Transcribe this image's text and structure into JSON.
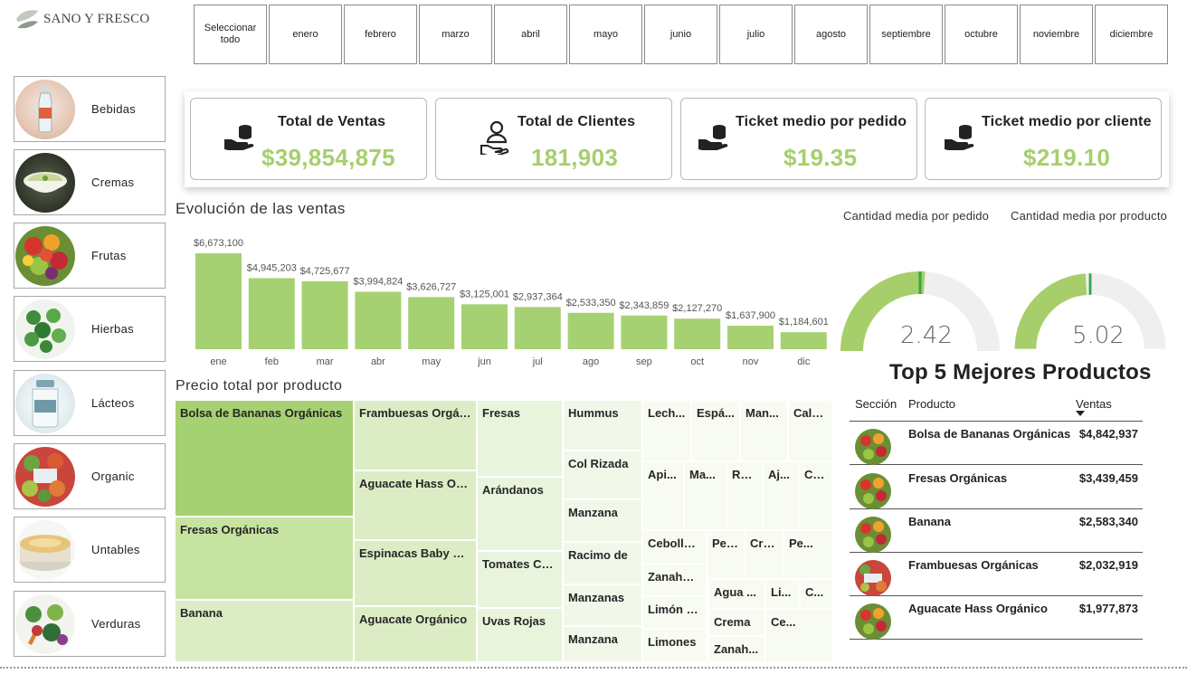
{
  "brand": {
    "name": "SANO Y FRESCO"
  },
  "months": [
    "Seleccionar todo",
    "enero",
    "febrero",
    "marzo",
    "abril",
    "mayo",
    "junio",
    "julio",
    "agosto",
    "septiembre",
    "octubre",
    "noviembre",
    "diciembre"
  ],
  "categories": [
    "Bebidas",
    "Cremas",
    "Frutas",
    "Hierbas",
    "Lácteos",
    "Organic",
    "Untables",
    "Verduras"
  ],
  "kpis": [
    {
      "title": "Total de Ventas",
      "value": "$39,854,875",
      "icon": "money-hand-icon"
    },
    {
      "title": "Total de Clientes",
      "value": "181,903",
      "icon": "customer-hand-icon"
    },
    {
      "title": "Ticket medio por pedido",
      "value": "$19.35",
      "icon": "money-hand-icon"
    },
    {
      "title": "Ticket medio por cliente",
      "value": "$219.10",
      "icon": "money-hand-icon"
    }
  ],
  "colors": {
    "accent": "#a6cf6c",
    "bar": "#a6d172",
    "gauge_track": "#efefef",
    "gauge_needle": "#3aa543"
  },
  "sales_chart": {
    "title": "Evolución de las ventas",
    "chart_data": {
      "type": "bar",
      "categories": [
        "ene",
        "feb",
        "mar",
        "abr",
        "may",
        "jun",
        "jul",
        "ago",
        "sep",
        "oct",
        "nov",
        "dic"
      ],
      "values": [
        6673100,
        4945203,
        4725677,
        3994824,
        3626727,
        3125001,
        2937364,
        2533350,
        2343859,
        2127270,
        1637900,
        1184601
      ],
      "labels": [
        "$6,673,100",
        "$4,945,203",
        "$4,725,677",
        "$3,994,824",
        "$3,626,727",
        "$3,125,001",
        "$2,937,364",
        "$2,533,350",
        "$2,343,859",
        "$2,127,270",
        "$1,637,900",
        "$1,184,601"
      ],
      "ylim": [
        0,
        6673100
      ],
      "grid": false
    }
  },
  "treemap": {
    "title": "Precio total por producto",
    "items": [
      "Bolsa de Bananas Orgánicas",
      "Fresas Orgánicas",
      "Banana",
      "Frambuesas Orgánicas",
      "Aguacate Hass Orgánico",
      "Espinacas Baby Orgánicas",
      "Aguacate Orgánico",
      "Fresas",
      "Arándanos",
      "Tomates Cherry",
      "Uvas Rojas",
      "Hummus",
      "Col Rizada",
      "Manzana",
      "Racimo de",
      "Manzanas",
      "Manzana",
      "Lech...",
      "Espá...",
      "Man...",
      "Cala...",
      "Api...",
      "Ma...",
      "Rú...",
      "Aj...",
      "Co...",
      "Cebolla ...",
      "Pepi...",
      "Cre...",
      "Pe...",
      "Zanahor...",
      "Agua ...",
      "Li...",
      "C...",
      "Limón G...",
      "Crema",
      "Limones",
      "Zanah...",
      "Ce..."
    ]
  },
  "gauges": [
    {
      "title": "Cantidad media por pedido",
      "value": "2.42",
      "fraction": 0.52
    },
    {
      "title": "Cantidad media por producto",
      "value": "5.02",
      "fraction": 0.48
    }
  ],
  "top5": {
    "title": "Top 5 Mejores Productos",
    "headers": [
      "Sección",
      "Producto",
      "Ventas"
    ],
    "rows": [
      {
        "product": "Bolsa de Bananas Orgánicas",
        "sales": "$4,842,937",
        "section_icon": "frutas-icon"
      },
      {
        "product": "Fresas Orgánicas",
        "sales": "$3,439,459",
        "section_icon": "frutas-icon"
      },
      {
        "product": "Banana",
        "sales": "$2,583,340",
        "section_icon": "frutas-icon"
      },
      {
        "product": "Frambuesas Orgánicas",
        "sales": "$2,032,919",
        "section_icon": "organic-icon"
      },
      {
        "product": "Aguacate Hass Orgánico",
        "sales": "$1,977,873",
        "section_icon": "frutas-icon"
      }
    ]
  }
}
